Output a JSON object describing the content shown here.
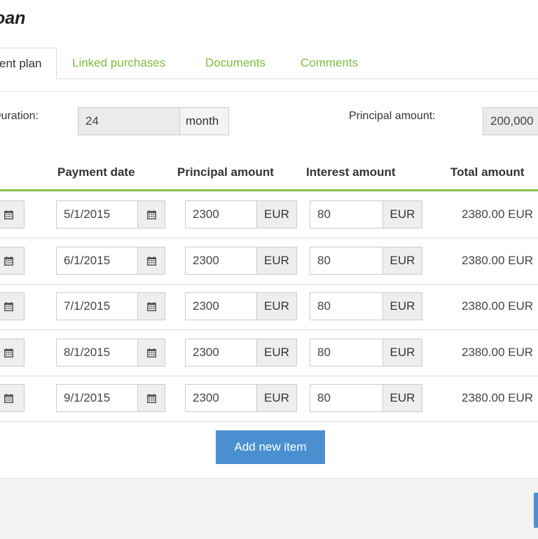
{
  "page": {
    "title": "oan"
  },
  "tabs": [
    {
      "label": "ent plan",
      "active": true
    },
    {
      "label": "Linked purchases",
      "active": false
    },
    {
      "label": "Documents",
      "active": false
    },
    {
      "label": "Comments",
      "active": false
    }
  ],
  "form": {
    "duration_label": "Duration:",
    "duration_value": "24",
    "duration_unit": "month",
    "principal_label": "Principal amount:",
    "principal_value": "200,000"
  },
  "table": {
    "columns": [
      "Payment date",
      "Principal amount",
      "Interest amount",
      "Total amount"
    ],
    "currency": "EUR",
    "rows": [
      {
        "date": "5/1/2015",
        "principal": "2300",
        "interest": "80",
        "total": "2380.00 EUR"
      },
      {
        "date": "6/1/2015",
        "principal": "2300",
        "interest": "80",
        "total": "2380.00 EUR"
      },
      {
        "date": "7/1/2015",
        "principal": "2300",
        "interest": "80",
        "total": "2380.00 EUR"
      },
      {
        "date": "8/1/2015",
        "principal": "2300",
        "interest": "80",
        "total": "2380.00 EUR"
      },
      {
        "date": "9/1/2015",
        "principal": "2300",
        "interest": "80",
        "total": "2380.00 EUR"
      }
    ]
  },
  "actions": {
    "add_item_label": "Add new item"
  },
  "colors": {
    "accent_green": "#7dbe3c",
    "primary_blue": "#4a90d0"
  },
  "icons": {
    "date_picker": "calendar-icon"
  }
}
